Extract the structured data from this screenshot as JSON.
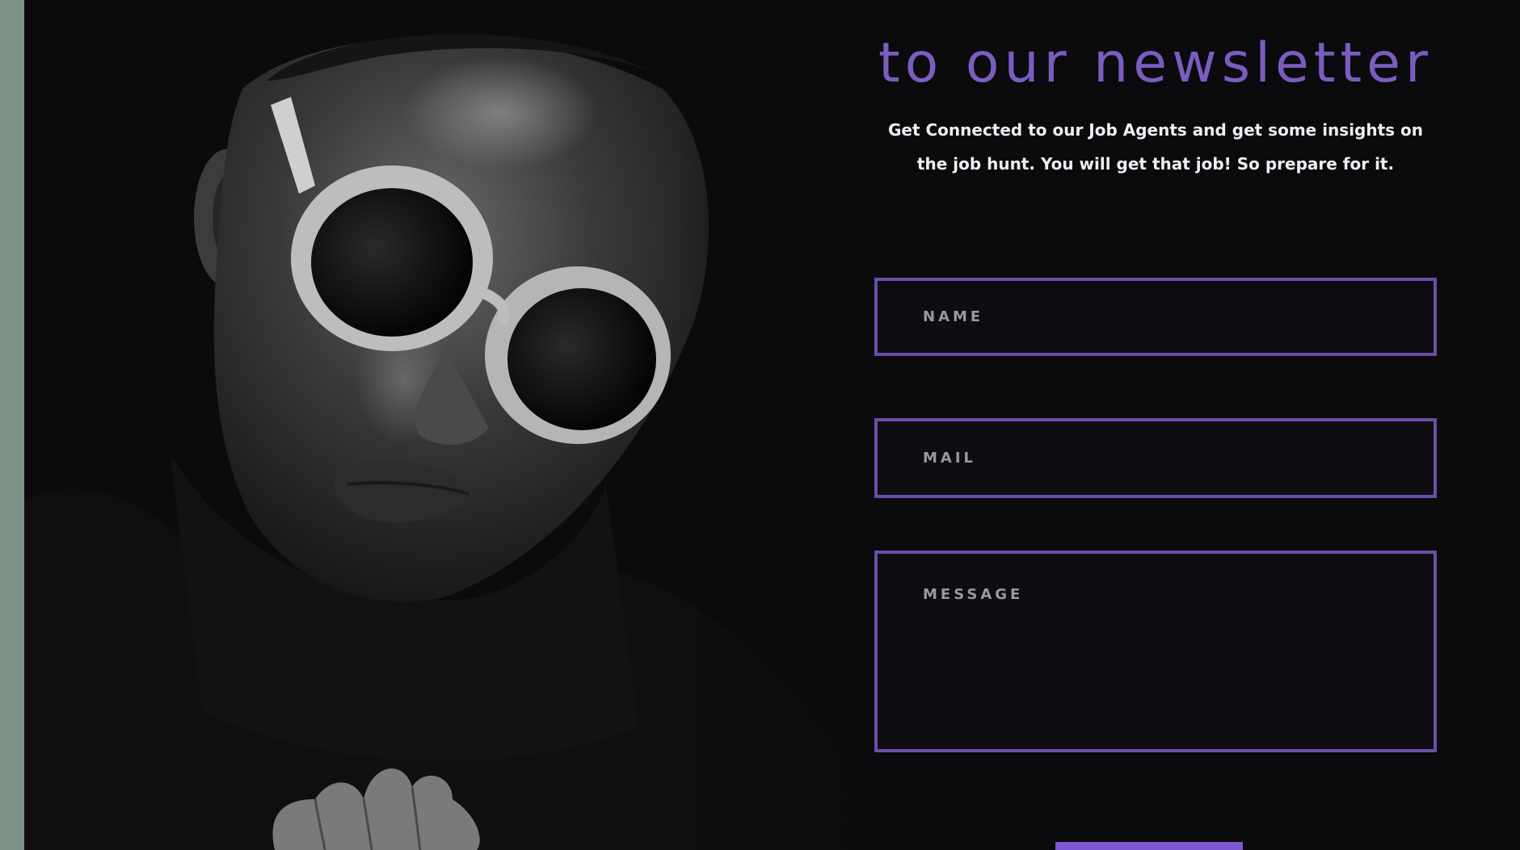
{
  "headline": "to our newsletter",
  "subtext": "Get Connected to our Job Agents and get some insights on the job hunt. You will get that job! So prepare for it.",
  "form": {
    "name_placeholder": "NAME",
    "mail_placeholder": "MAIL",
    "message_placeholder": "MESSAGE"
  },
  "colors": {
    "background": "#0b0a0c",
    "accent": "#7c5cc0",
    "field_border": "#6a4ea8",
    "button": "#7d56d4",
    "side_strip": "#7f9288"
  }
}
